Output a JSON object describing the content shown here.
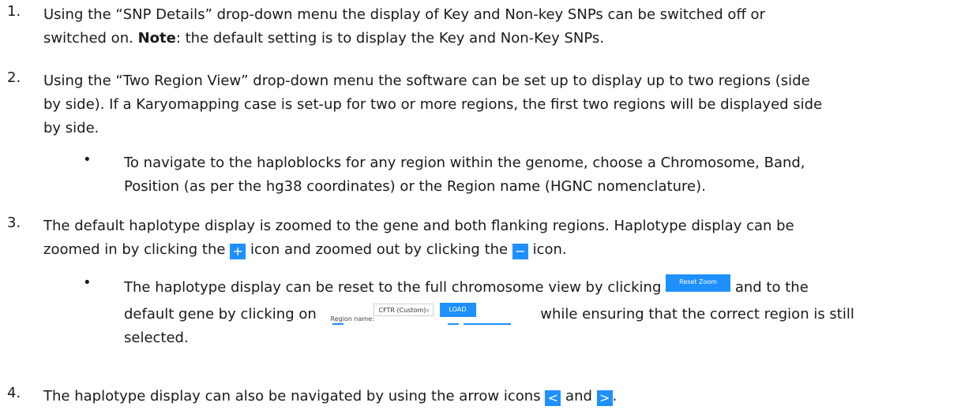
{
  "items": [
    {
      "number": "1.",
      "lines": [
        "Using the “SNP Details” drop-down menu the display of Key and Non-key SNPs can be switched off or",
        "switched on."
      ],
      "note_label": "Note",
      "note_text": ": the default setting is to display the Key and Non-Key SNPs."
    },
    {
      "number": "2.",
      "lines": [
        "Using the “Two Region View” drop-down menu the software can be set up to display up to two regions (side",
        "by side). If a Karyomapping case is set-up for two or more regions, the first two regions will be displayed side",
        "by side."
      ],
      "bullet": [
        "To navigate to the haploblocks for any region within the genome, choose a Chromosome, Band,",
        "Position (as per the hg38 coordinates) or the Region name (HGNC nomenclature)."
      ]
    },
    {
      "number": "3.",
      "line1": "The default haplotype display is zoomed to the gene and both flanking regions. Haplotype display can be",
      "line2_a": "zoomed in by clicking the",
      "line2_b": "icon and zoomed out by clicking the",
      "line2_c": "icon.",
      "bullet_line1_a": "The haplotype display can be reset to the full chromosome view by clicking",
      "bullet_line1_b": "and to the",
      "bullet_line2_a": "default gene by clicking on",
      "bullet_line2_b": "while ensuring that the correct region is still",
      "bullet_line3": "selected."
    },
    {
      "number": "4.",
      "line_a": "The haplotype display can also be navigated by using the arrow icons",
      "line_b": "and",
      "line_c": "."
    }
  ],
  "icons": {
    "plus": "+",
    "minus": "−",
    "left": "<",
    "right": ">",
    "chevron": "∨"
  },
  "reset_zoom_label": "Reset Zoom",
  "region_control": {
    "label": "Region name:",
    "value": "CFTR (Custom)",
    "load_label": "LOAD"
  },
  "colors": {
    "accent": "#1e90ff"
  }
}
